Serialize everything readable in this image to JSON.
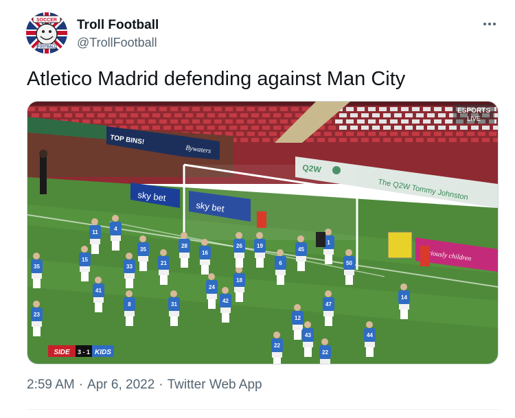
{
  "author": {
    "name": "Troll Football",
    "handle": "@TrollFootball"
  },
  "avatar": {
    "badge_top": "SOCCER",
    "badge_bottom": "FOOTBALL"
  },
  "tweet": {
    "text": "Atletico Madrid defending against Man City"
  },
  "media": {
    "stadium_signs": {
      "top_bins": "TOP BINS!",
      "bywaters": "Bywaters",
      "sky_bet_1": "sky bet",
      "sky_bet_2": "sky bet",
      "q2w": "Q2W",
      "q2w_stand": "The Q2W Tommy Johnston",
      "esports": "ESPORTS",
      "esports_sub": "LIVE",
      "seriously": "seriously children"
    },
    "scoreboard": {
      "left_team": "SIDE",
      "score": "3 - 1",
      "right_team": "KIDS"
    },
    "shirt_numbers": [
      "11",
      "15",
      "41",
      "33",
      "35",
      "21",
      "28",
      "16",
      "19",
      "24",
      "18",
      "26",
      "45",
      "1",
      "50",
      "6",
      "14",
      "42",
      "31",
      "8",
      "47",
      "12",
      "43",
      "44",
      "22",
      "23",
      "35",
      "22",
      "4"
    ],
    "colors": {
      "pitch": "#4f8a3a",
      "stand": "#b23038",
      "kit": "#2f6cc4",
      "sky_bet": "#1b3f99",
      "keeper": "#d93a2a"
    }
  },
  "footer": {
    "time": "2:59 AM",
    "date": "Apr 6, 2022",
    "source": "Twitter Web App",
    "separator": "·"
  }
}
